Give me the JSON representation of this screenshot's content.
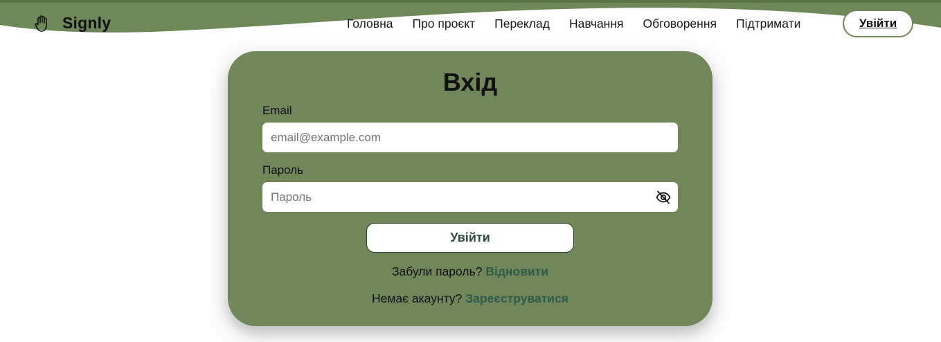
{
  "header": {
    "logo_text": "Signly",
    "logo_icon": "hand-icon",
    "nav": [
      {
        "label": "Головна"
      },
      {
        "label": "Про проєкт"
      },
      {
        "label": "Переклад"
      },
      {
        "label": "Навчання"
      },
      {
        "label": "Обговорення"
      },
      {
        "label": "Підтримати"
      }
    ],
    "login_button": "Увійти"
  },
  "login_card": {
    "title": "Вхід",
    "email_label": "Email",
    "email_placeholder": "email@example.com",
    "email_value": "",
    "password_label": "Пароль",
    "password_placeholder": "Пароль",
    "password_value": "",
    "password_toggle_icon": "eye-slash-icon",
    "submit_label": "Увійти",
    "forgot_text": "Забули пароль?",
    "forgot_link": "Відновити",
    "register_text": "Немає акаунту?",
    "register_link": "Зареєструватися"
  },
  "colors": {
    "brand_green": "#71865a",
    "header_wave": "#6f8859",
    "link_green": "#2d5c48",
    "background": "#fdfdfd"
  }
}
